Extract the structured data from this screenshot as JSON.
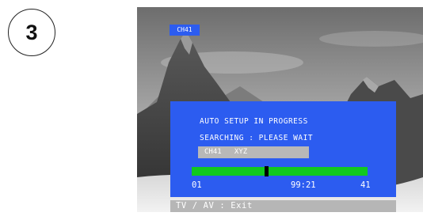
{
  "step": {
    "number": "3"
  },
  "tv": {
    "channel_tag": "CH41",
    "osd": {
      "line1": "AUTO SETUP IN PROGRESS",
      "line2": "SEARCHING : PLEASE WAIT",
      "channel_name_bar": "CH41   XYZ",
      "progress": {
        "start_label": "01",
        "current_label": "99:21",
        "end_label": "41",
        "marker_fraction": 0.425,
        "bar_color": "#11c81f",
        "marker_color": "#000000"
      }
    },
    "footer": {
      "exit_hint": "TV / AV : Exit"
    },
    "colors": {
      "osd_blue": "#2c5cf0",
      "name_bar_gray": "#b8b8b8",
      "footer_gray": "#b6b6b6"
    }
  }
}
